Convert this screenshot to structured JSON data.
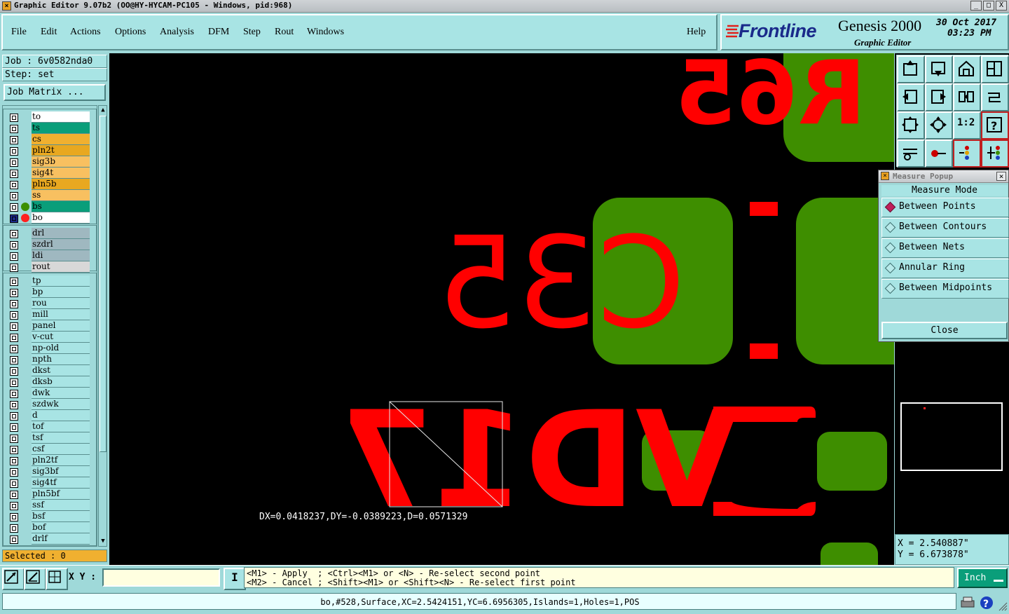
{
  "window": {
    "title": "Graphic Editor 9.07b2 (OO@HY-HYCAM-PC105 - Windows, pid:968)",
    "buttons": [
      "_",
      "□",
      "X"
    ]
  },
  "menu": {
    "items": [
      "File",
      "Edit",
      "Actions",
      "Options",
      "Analysis",
      "DFM",
      "Step",
      "Rout",
      "Windows"
    ],
    "help": "Help"
  },
  "brand": {
    "logo": "Frontline",
    "product": "Genesis 2000",
    "subtitle": "Graphic Editor",
    "date": "30 Oct 2017",
    "time": "03:23 PM"
  },
  "job": {
    "job_label": "Job : 6v0582nda0",
    "step_label": "Step: set",
    "matrix_button": "Job Matrix ..."
  },
  "layers_board": [
    {
      "name": "to",
      "color": "#ffffff",
      "dot": ""
    },
    {
      "name": "ts",
      "color": "#0a9e7a",
      "dot": ""
    },
    {
      "name": "cs",
      "color": "#f0b030",
      "dot": ""
    },
    {
      "name": "pln2t",
      "color": "#e8a820",
      "dot": ""
    },
    {
      "name": "sig3b",
      "color": "#f8c060",
      "dot": ""
    },
    {
      "name": "sig4t",
      "color": "#f8c060",
      "dot": ""
    },
    {
      "name": "pln5b",
      "color": "#e8a820",
      "dot": ""
    },
    {
      "name": "ss",
      "color": "#f8c060",
      "dot": ""
    },
    {
      "name": "bs",
      "color": "#0a9e7a",
      "dot": "#3c8f00"
    },
    {
      "name": "bo",
      "color": "#ffffff",
      "dot": "#ff2020"
    }
  ],
  "layers_drill": [
    {
      "name": "drl",
      "color": "#9fb8c0"
    },
    {
      "name": "szdrl",
      "color": "#9fb8c0"
    },
    {
      "name": "ldi",
      "color": "#9fb8c0"
    },
    {
      "name": "rout",
      "color": "#d8d8d8"
    }
  ],
  "layers_misc": [
    "tp",
    "bp",
    "rou",
    "mill",
    "panel",
    "v-cut",
    "np-old",
    "npth",
    "dkst",
    "dksb",
    "dwk",
    "szdwk",
    "d",
    "tof",
    "tsf",
    "csf",
    "pln2tf",
    "sig3bf",
    "sig4tf",
    "pln5bf",
    "ssf",
    "bsf",
    "bof",
    "drlf"
  ],
  "selected_label": "Selected : 0",
  "canvas": {
    "measure_text": "DX=0.0418237,DY=-0.0389223,D=0.0571329",
    "silkscreen": [
      "R65",
      "C35",
      "VD17"
    ]
  },
  "measure_popup": {
    "title": "Measure Popup",
    "heading": "Measure Mode",
    "options": [
      "Between Points",
      "Between Contours",
      "Between Nets",
      "Annular Ring",
      "Between Midpoints"
    ],
    "selected": "Between Points",
    "close": "Close"
  },
  "tools": [
    "home-icon",
    "zoom-icon",
    "ratio-1-2-icon",
    "help-icon"
  ],
  "tool_ratio_label": "1:2",
  "coords": {
    "x": "X = 2.540887\"",
    "y": "Y = 6.673878\""
  },
  "bottom": {
    "xy_label": "X Y :",
    "xy_value": "",
    "hint1": "<M1> - Apply  ; <Ctrl><M1> or <N> - Re-select second point",
    "hint2": "<M2> - Cancel ; <Shift><M1> or <Shift><N> - Re-select first point",
    "unit": "Inch",
    "status": "bo,#528,Surface,XC=2.5424151,YC=6.6956305,Islands=1,Holes=1,POS"
  }
}
